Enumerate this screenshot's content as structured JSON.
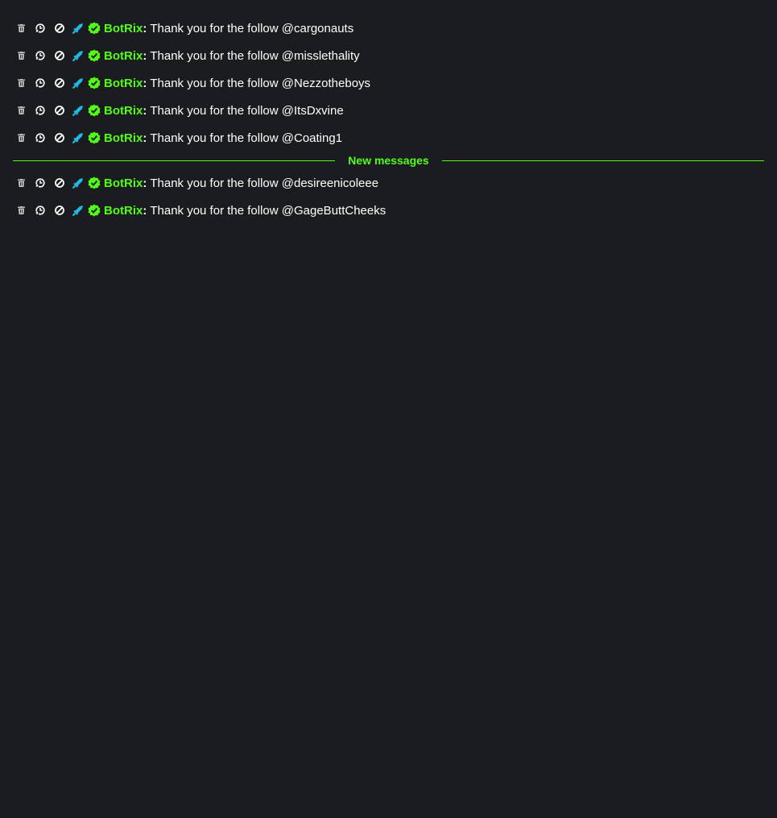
{
  "colors": {
    "background": "#1b1c1f",
    "accent": "#53fc18",
    "mod_sword": "#22b8e6",
    "verified": "#53fc18",
    "text": "#ffffff"
  },
  "mod_actions": [
    "trash-icon",
    "timeout-icon",
    "ban-icon"
  ],
  "badges": [
    "moderator-sword-icon",
    "verified-check-icon"
  ],
  "messages_before": [
    {
      "username": "BotRix",
      "separator": ":",
      "text": "Thank you for the follow @cargonauts"
    },
    {
      "username": "BotRix",
      "separator": ":",
      "text": "Thank you for the follow @misslethality"
    },
    {
      "username": "BotRix",
      "separator": ":",
      "text": "Thank you for the follow @Nezzotheboys"
    },
    {
      "username": "BotRix",
      "separator": ":",
      "text": "Thank you for the follow @ItsDxvine"
    },
    {
      "username": "BotRix",
      "separator": ":",
      "text": "Thank you for the follow @Coating1"
    }
  ],
  "divider": {
    "label": "New messages"
  },
  "messages_after": [
    {
      "username": "BotRix",
      "separator": ":",
      "text": "Thank you for the follow @desireenicoleee"
    },
    {
      "username": "BotRix",
      "separator": ":",
      "text": "Thank you for the follow @GageButtCheeks"
    }
  ]
}
